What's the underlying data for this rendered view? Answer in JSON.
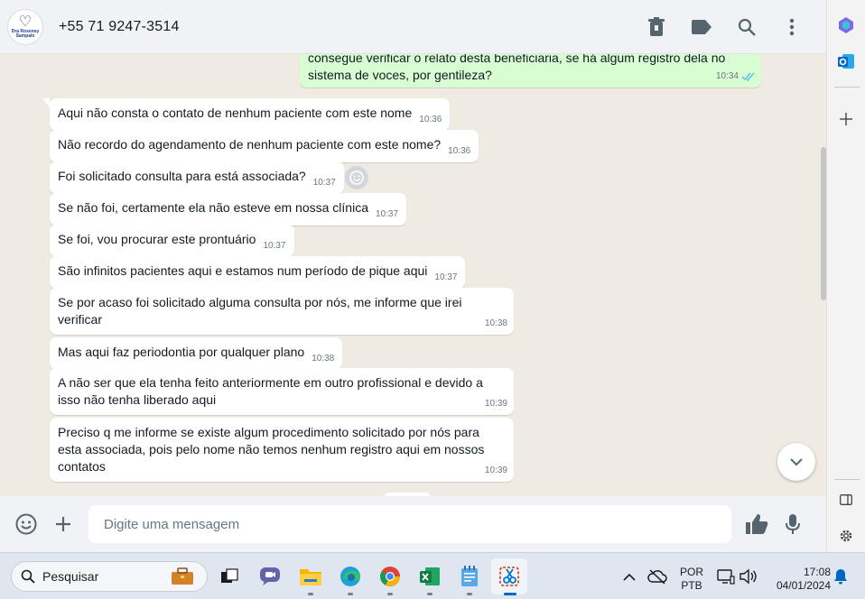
{
  "header": {
    "avatar_line1": "Dra Roseney",
    "avatar_line2": "Sampaio",
    "contact": "+55 71 9247-3514"
  },
  "outgoing": {
    "line1": "consegue verificar o relato desta beneficiaria, se há algum registro dela no",
    "line2": "sistema de voces, por gentileza?",
    "time": "10:34"
  },
  "messages": [
    {
      "text": "Aqui não consta o contato de nenhum paciente com este nome",
      "time": "10:36"
    },
    {
      "text": "Não recordo do agendamento de nenhum paciente com este nome?",
      "time": "10:36"
    },
    {
      "text": "Foi solicitado consulta para está associada?",
      "time": "10:37"
    },
    {
      "text": "Se não foi, certamente ela não esteve em nossa clínica",
      "time": "10:37"
    },
    {
      "text": "Se foi, vou procurar este prontuário",
      "time": "10:37"
    },
    {
      "text": "São infinitos pacientes aqui e estamos num período de pique aqui",
      "time": "10:37"
    },
    {
      "text": "Se por acaso foi solicitado alguma consulta por nós, me informe que irei verificar",
      "time": "10:38"
    },
    {
      "text": "Mas aqui faz periodontia por qualquer plano",
      "time": "10:38"
    },
    {
      "text": "A não ser que ela tenha feito anteriormente em outro profissional e devido a isso não tenha liberado aqui",
      "time": "10:39"
    },
    {
      "text": "Preciso q me informe se existe algum procedimento solicitado por nós para esta associada, pois pelo nome não temos nenhum registro aqui em nossos contatos",
      "time": "10:39"
    }
  ],
  "composer": {
    "placeholder": "Digite uma mensagem"
  },
  "taskbar": {
    "search_label": "Pesquisar",
    "lang_line1": "POR",
    "lang_line2": "PTB",
    "clock_time": "17:08",
    "clock_date": "04/01/2024"
  },
  "colors": {
    "outgoing_bubble": "#d9fdd3",
    "incoming_bubble": "#ffffff",
    "chat_background": "#efeae2",
    "read_ticks": "#53bdeb"
  },
  "icons": {
    "header": [
      "trash-icon",
      "label-icon",
      "search-icon",
      "more-vertical-icon"
    ],
    "composer": [
      "emoji-icon",
      "plus-icon",
      "thumbs-up-icon",
      "mic-icon"
    ],
    "side": [
      "copilot-icon",
      "outlook-icon",
      "add-icon",
      "sidebar-icon",
      "settings-icon"
    ]
  }
}
